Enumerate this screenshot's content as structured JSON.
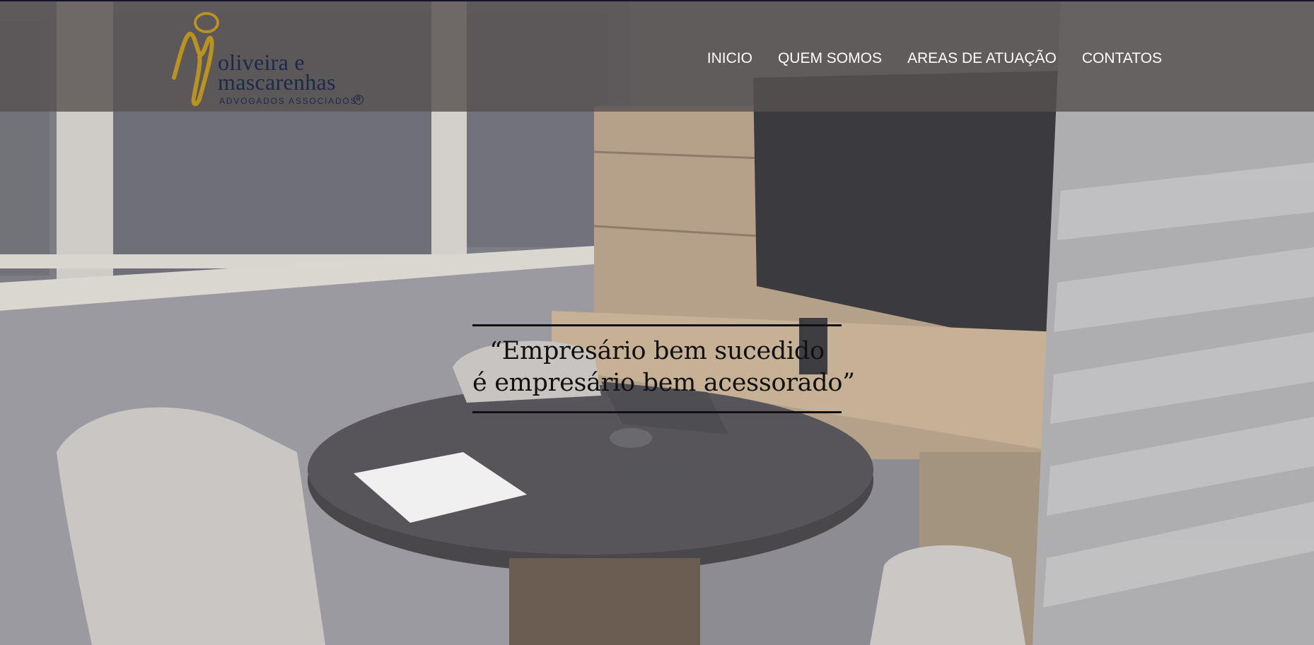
{
  "brand": {
    "name_line1": "oliveira e",
    "name_line2": "mascarenhas",
    "tagline": "ADVOGADOS ASSOCIADOS",
    "registered_mark": "R",
    "colors": {
      "mark_gold": "#b89322",
      "text_navy": "#1c2a4a"
    }
  },
  "nav": {
    "items": [
      {
        "label": "INICIO"
      },
      {
        "label": "QUEM SOMOS"
      },
      {
        "label": "AREAS DE ATUAÇÃO"
      },
      {
        "label": "CONTATOS"
      }
    ]
  },
  "hero": {
    "quote_line1": "“Empresário bem sucedido",
    "quote_line2": "é empresário bem acessorado”"
  },
  "colors": {
    "header_overlay": "#585250",
    "quote_text": "#111111",
    "nav_text": "#ffffff"
  }
}
